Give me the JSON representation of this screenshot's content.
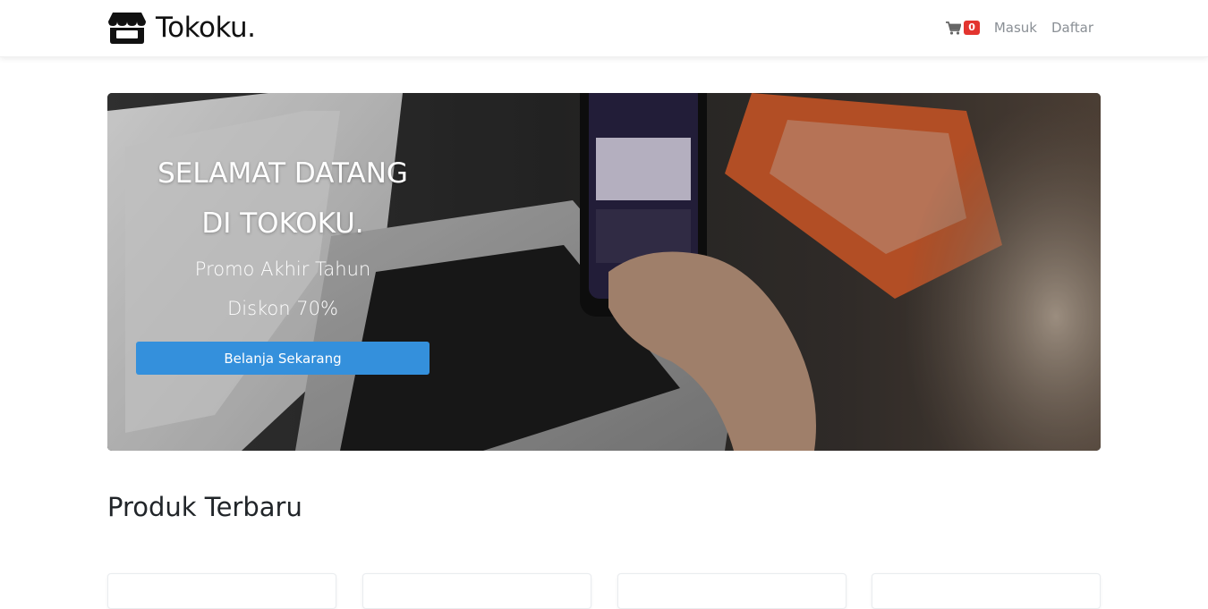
{
  "navbar": {
    "brand": "Tokoku.",
    "cart_count": "0",
    "login_label": "Masuk",
    "register_label": "Daftar"
  },
  "hero": {
    "title_line1": "SELAMAT DATANG",
    "title_line2": "DI TOKOKU.",
    "subtitle_line1": "Promo Akhir Tahun",
    "subtitle_line2": "Diskon 70%",
    "button_label": "Belanja Sekarang"
  },
  "section": {
    "title": "Produk Terbaru"
  },
  "colors": {
    "primary": "#3490dc",
    "badge": "#e3342f",
    "nav_link": "#8a8f95"
  },
  "icons": {
    "brand": "store-icon",
    "cart": "shopping-cart-icon"
  }
}
